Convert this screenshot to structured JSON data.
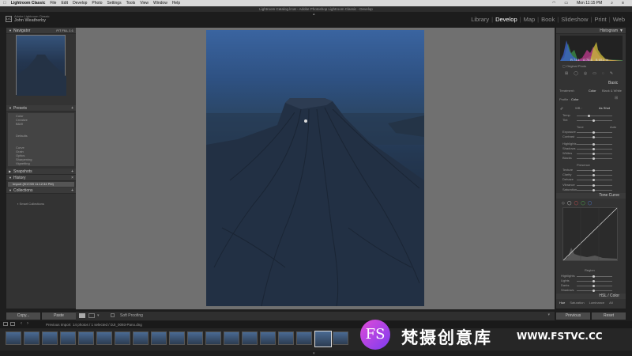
{
  "menubar": {
    "apple": "",
    "items": [
      "Lightroom Classic",
      "File",
      "Edit",
      "Develop",
      "Photo",
      "Settings",
      "Tools",
      "View",
      "Window",
      "Help"
    ],
    "clock": "Mon 11:15 PM"
  },
  "window_title": "Lightroom Catalog.lrcat - Adobe Photoshop Lightroom Classic - Develop",
  "identity": {
    "app": "Adobe Lightroom Classic",
    "user": "John Weatherby",
    "logo": "LrC"
  },
  "modules": [
    "Library",
    "Develop",
    "Map",
    "Book",
    "Slideshow",
    "Print",
    "Web"
  ],
  "active_module": "Develop",
  "left_panel": {
    "navigator": "Navigator",
    "presets": {
      "title": "Presets",
      "items": [
        "Color",
        "Creative",
        "B&W",
        "Defaults",
        "Curve",
        "Grain",
        "Optics",
        "Sharpening",
        "Vignetting"
      ]
    },
    "snapshots": "Snapshots",
    "history": {
      "title": "History",
      "item": "Import (9/17/20 11:12:34 PM)"
    },
    "collections": {
      "title": "Collections",
      "item": "Smart Collections"
    },
    "copy": "Copy...",
    "paste": "Paste"
  },
  "toolbar": {
    "soft_proofing": "Soft Proofing"
  },
  "right_panel": {
    "histogram": "Histogram",
    "hist_values": {
      "r": "R  74.1",
      "g": "G  76.6",
      "b": "B  69.2 %"
    },
    "original_photo": "Original Photo",
    "basic": "Basic",
    "treatment_label": "Treatment :",
    "treatment_color": "Color",
    "treatment_bw": "Black & White",
    "profile_label": "Profile :",
    "profile_value": "Color",
    "wb_label": "WB :",
    "wb_value": "As Shot",
    "basic_rows": [
      "Temp",
      "Tint",
      "Exposure",
      "Contrast",
      "Highlights",
      "Shadows",
      "Whites",
      "Blacks",
      "Texture",
      "Clarity",
      "Dehaze",
      "Vibrance",
      "Saturation"
    ],
    "tone_label": "Tone",
    "tone_auto": "Auto",
    "presence_label": "Presence",
    "tone_curve": "Tone Curve",
    "region": "Region",
    "curve_rows": [
      "Highlights",
      "Lights",
      "Darks",
      "Shadows"
    ],
    "hsl": "HSL / Color",
    "hsl_tabs": [
      "Hue",
      "Saturation",
      "Luminance",
      "All"
    ],
    "previous": "Previous",
    "reset": "Reset"
  },
  "filmstrip": {
    "source": "Previous Import",
    "count": "14 photos / 1 selected / DJI_0093-Pano.dng",
    "frames": 19,
    "selected_index": 17
  },
  "watermark": {
    "logo": "FS",
    "text": "梵摄创意库",
    "url": "WWW.FSTVC.CC"
  },
  "colors": {
    "accent_active_module": "#ffffff",
    "panel_bg": "#333333",
    "center_bg": "#707070"
  }
}
